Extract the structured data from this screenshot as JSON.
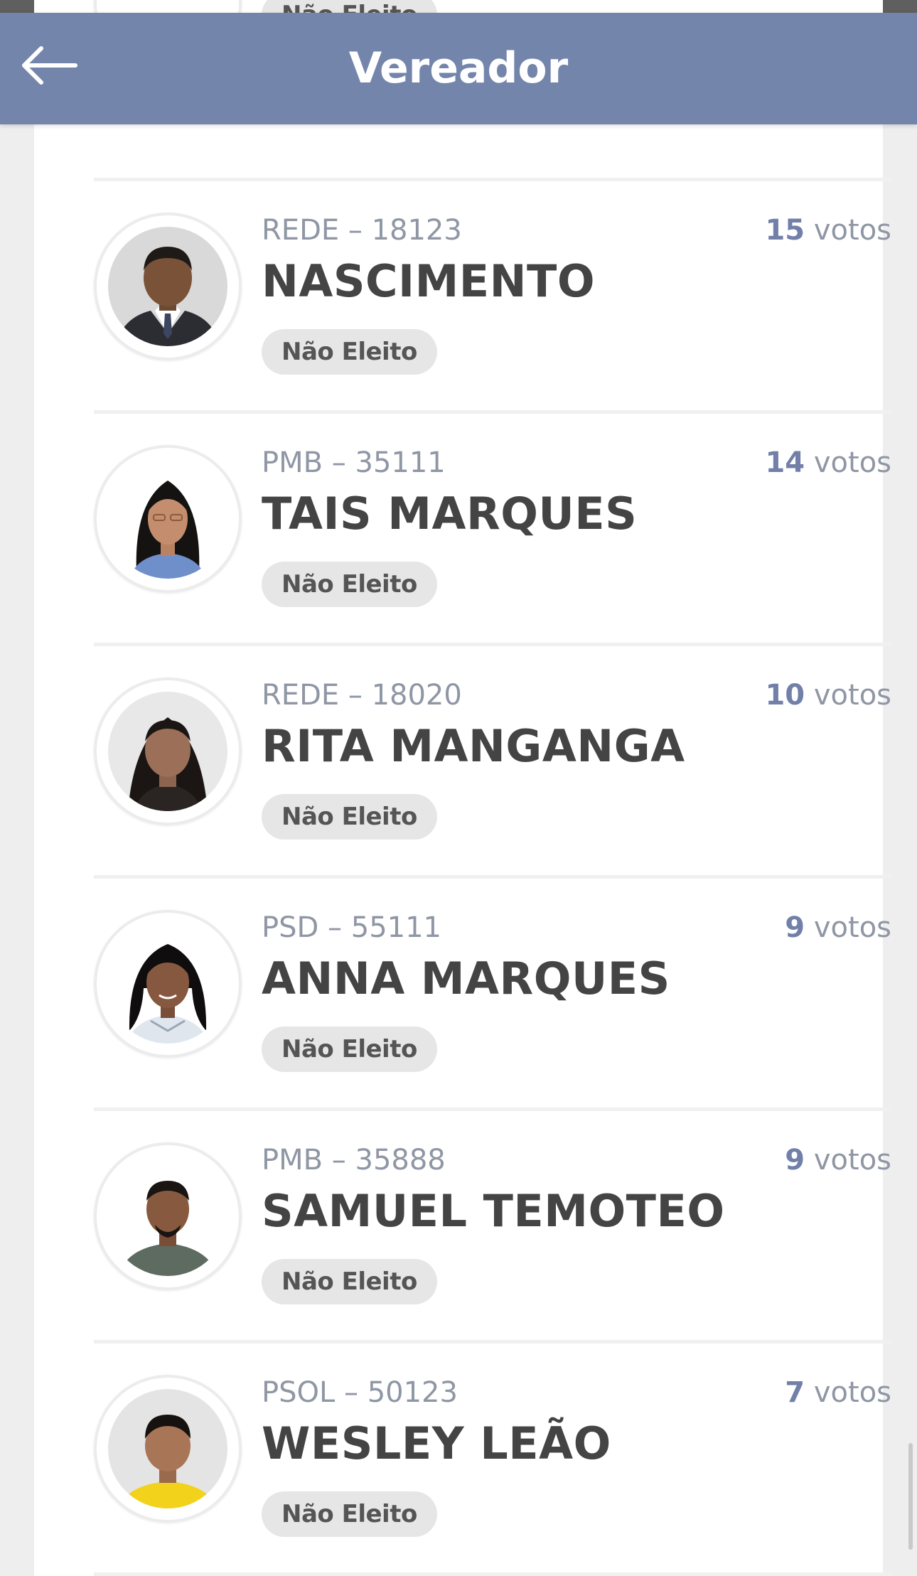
{
  "header": {
    "title": "Vereador",
    "back_icon": "arrow-left-icon",
    "background": "#7485ac"
  },
  "colors": {
    "vote_count": "#7280a9",
    "muted_text": "#8f96a4",
    "name_text": "#444444",
    "badge_bg": "#e6e6e6"
  },
  "partial_row": {
    "status": "Não Eleito"
  },
  "candidates": [
    {
      "party": "REDE – 18123",
      "name": "NASCIMENTO",
      "votes": "15",
      "votes_unit": "votos",
      "status": "Não Eleito"
    },
    {
      "party": "PMB – 35111",
      "name": "TAIS MARQUES",
      "votes": "14",
      "votes_unit": "votos",
      "status": "Não Eleito"
    },
    {
      "party": "REDE – 18020",
      "name": "RITA MANGANGA",
      "votes": "10",
      "votes_unit": "votos",
      "status": "Não Eleito"
    },
    {
      "party": "PSD – 55111",
      "name": "ANNA MARQUES",
      "votes": "9",
      "votes_unit": "votos",
      "status": "Não Eleito"
    },
    {
      "party": "PMB – 35888",
      "name": "SAMUEL TEMOTEO",
      "votes": "9",
      "votes_unit": "votos",
      "status": "Não Eleito"
    },
    {
      "party": "PSOL – 50123",
      "name": "WESLEY LEÃO",
      "votes": "7",
      "votes_unit": "votos",
      "status": "Não Eleito"
    }
  ]
}
